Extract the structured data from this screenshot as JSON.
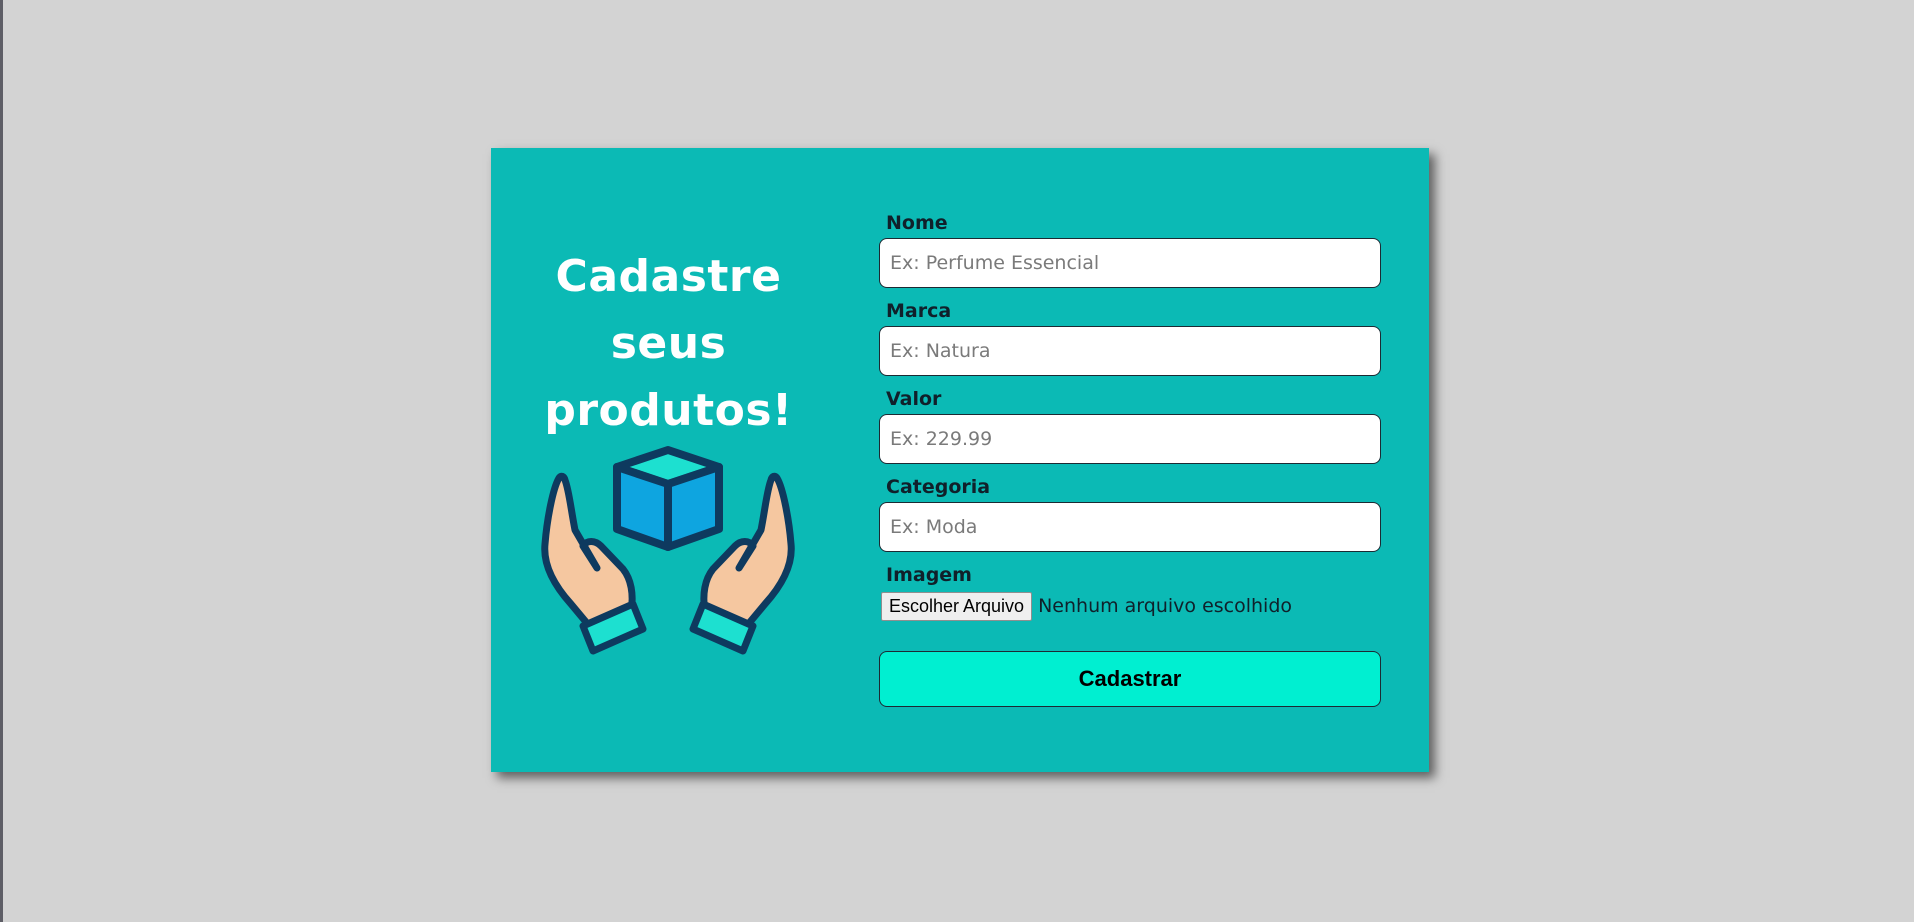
{
  "hero": {
    "title_line1": "Cadastre",
    "title_line2": "seus",
    "title_line3": "produtos!",
    "illustration_icon": "hands-holding-box-icon"
  },
  "form": {
    "fields": [
      {
        "label": "Nome",
        "placeholder": "Ex: Perfume Essencial",
        "value": ""
      },
      {
        "label": "Marca",
        "placeholder": "Ex: Natura",
        "value": ""
      },
      {
        "label": "Valor",
        "placeholder": "Ex: 229.99",
        "value": ""
      },
      {
        "label": "Categoria",
        "placeholder": "Ex: Moda",
        "value": ""
      }
    ],
    "image": {
      "label": "Imagem",
      "button_label": "Escolher Arquivo",
      "status": "Nenhum arquivo escolhido"
    },
    "submit_label": "Cadastrar"
  },
  "colors": {
    "page_background": "#d3d3d3",
    "card_background": "#0bbab5",
    "submit_background": "#00efd1",
    "title_text": "#ffffff"
  }
}
